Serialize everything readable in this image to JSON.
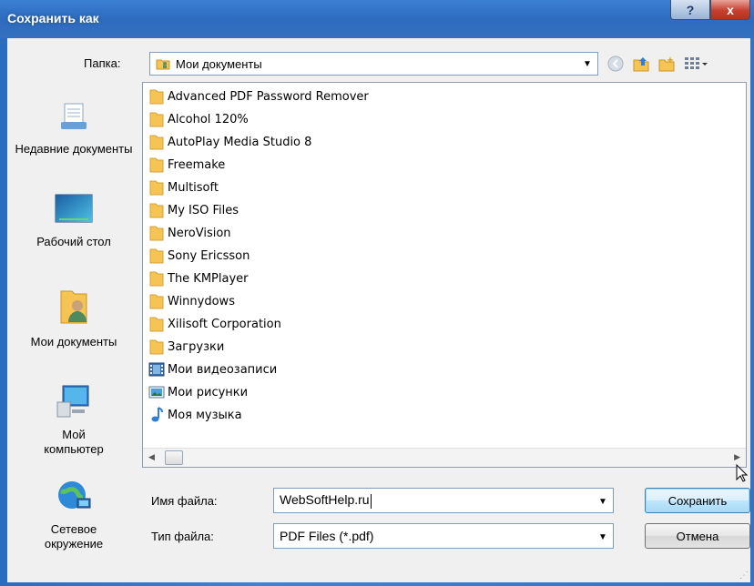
{
  "window": {
    "title": "Сохранить как",
    "help_label": "?",
    "close_label": "x"
  },
  "folder_bar": {
    "label": "Папка:",
    "current": "Мои документы"
  },
  "places": [
    {
      "label": "Недавние документы",
      "icon": "recent-documents-icon"
    },
    {
      "label": "Рабочий стол",
      "icon": "desktop-icon"
    },
    {
      "label": "Мои документы",
      "icon": "my-documents-icon"
    },
    {
      "label": "Мой компьютер",
      "icon": "my-computer-icon"
    },
    {
      "label": "Сетевое окружение",
      "icon": "network-icon"
    }
  ],
  "files": [
    {
      "name": "Advanced PDF Password Remover",
      "icon": "folder-icon"
    },
    {
      "name": "Alcohol 120%",
      "icon": "folder-icon"
    },
    {
      "name": "AutoPlay Media Studio 8",
      "icon": "folder-icon"
    },
    {
      "name": "Freemake",
      "icon": "folder-icon"
    },
    {
      "name": "Multisoft",
      "icon": "folder-icon"
    },
    {
      "name": "My ISO Files",
      "icon": "folder-icon"
    },
    {
      "name": "NeroVision",
      "icon": "folder-icon"
    },
    {
      "name": "Sony Ericsson",
      "icon": "folder-icon"
    },
    {
      "name": "The KMPlayer",
      "icon": "folder-icon"
    },
    {
      "name": "Winnydows",
      "icon": "folder-icon"
    },
    {
      "name": "Xilisoft Corporation",
      "icon": "folder-icon"
    },
    {
      "name": "Загрузки",
      "icon": "folder-icon"
    },
    {
      "name": "Мои видеозаписи",
      "icon": "videos-folder-icon"
    },
    {
      "name": "Мои рисунки",
      "icon": "pictures-folder-icon"
    },
    {
      "name": "Моя музыка",
      "icon": "music-folder-icon"
    }
  ],
  "filename": {
    "label": "Имя файла:",
    "value": "WebSoftHelp.ru"
  },
  "filetype": {
    "label": "Тип файла:",
    "value": "PDF Files (*.pdf)"
  },
  "buttons": {
    "save": "Сохранить",
    "cancel": "Отмена"
  },
  "colors": {
    "titlebar": "#2e6cc0",
    "folder": "#f5c453",
    "default_button": "#bee6fd"
  }
}
